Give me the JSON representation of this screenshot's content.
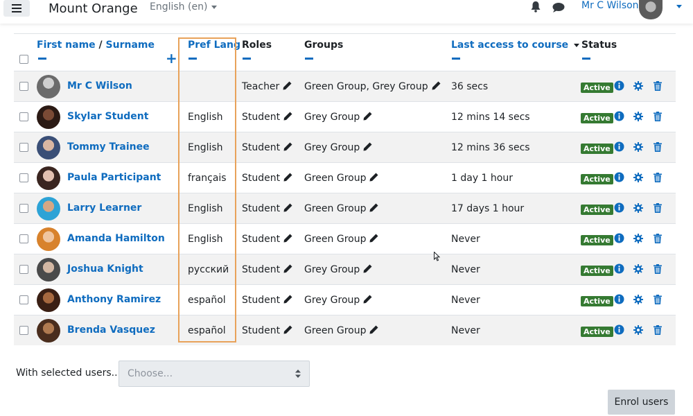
{
  "header": {
    "site_name": "Mount Orange",
    "language": "English (en)",
    "user_name": "Mr C Wilson"
  },
  "table": {
    "headers": {
      "first_name": "First name",
      "separator": "/",
      "surname": "Surname",
      "pref_lang": "Pref Lang",
      "roles": "Roles",
      "groups": "Groups",
      "last_access": "Last access to course",
      "status": "Status"
    },
    "rows": [
      {
        "name": "Mr C Wilson",
        "lang": "",
        "role": "Teacher",
        "groups": "Green Group, Grey Group",
        "last_access": "36 secs",
        "status": "Active"
      },
      {
        "name": "Skylar Student",
        "lang": "English",
        "role": "Student",
        "groups": "Grey Group",
        "last_access": "12 mins 14 secs",
        "status": "Active"
      },
      {
        "name": "Tommy Trainee",
        "lang": "English",
        "role": "Student",
        "groups": "Grey Group",
        "last_access": "12 mins 36 secs",
        "status": "Active"
      },
      {
        "name": "Paula Participant",
        "lang": "français",
        "role": "Student",
        "groups": "Green Group",
        "last_access": "1 day 1 hour",
        "status": "Active"
      },
      {
        "name": "Larry Learner",
        "lang": "English",
        "role": "Student",
        "groups": "Green Group",
        "last_access": "17 days 1 hour",
        "status": "Active"
      },
      {
        "name": "Amanda Hamilton",
        "lang": "English",
        "role": "Student",
        "groups": "Green Group",
        "last_access": "Never",
        "status": "Active"
      },
      {
        "name": "Joshua Knight",
        "lang": "русский",
        "role": "Student",
        "groups": "Grey Group",
        "last_access": "Never",
        "status": "Active"
      },
      {
        "name": "Anthony Ramirez",
        "lang": "español",
        "role": "Student",
        "groups": "Grey Group",
        "last_access": "Never",
        "status": "Active"
      },
      {
        "name": "Brenda Vasquez",
        "lang": "español",
        "role": "Student",
        "groups": "Green Group",
        "last_access": "Never",
        "status": "Active"
      }
    ]
  },
  "footer": {
    "with_selected": "With selected users...",
    "choose_placeholder": "Choose...",
    "enrol_button": "Enrol users"
  },
  "colors": {
    "link": "#0f6cbf",
    "active_badge": "#357a32",
    "highlight": "#e8a25a"
  }
}
